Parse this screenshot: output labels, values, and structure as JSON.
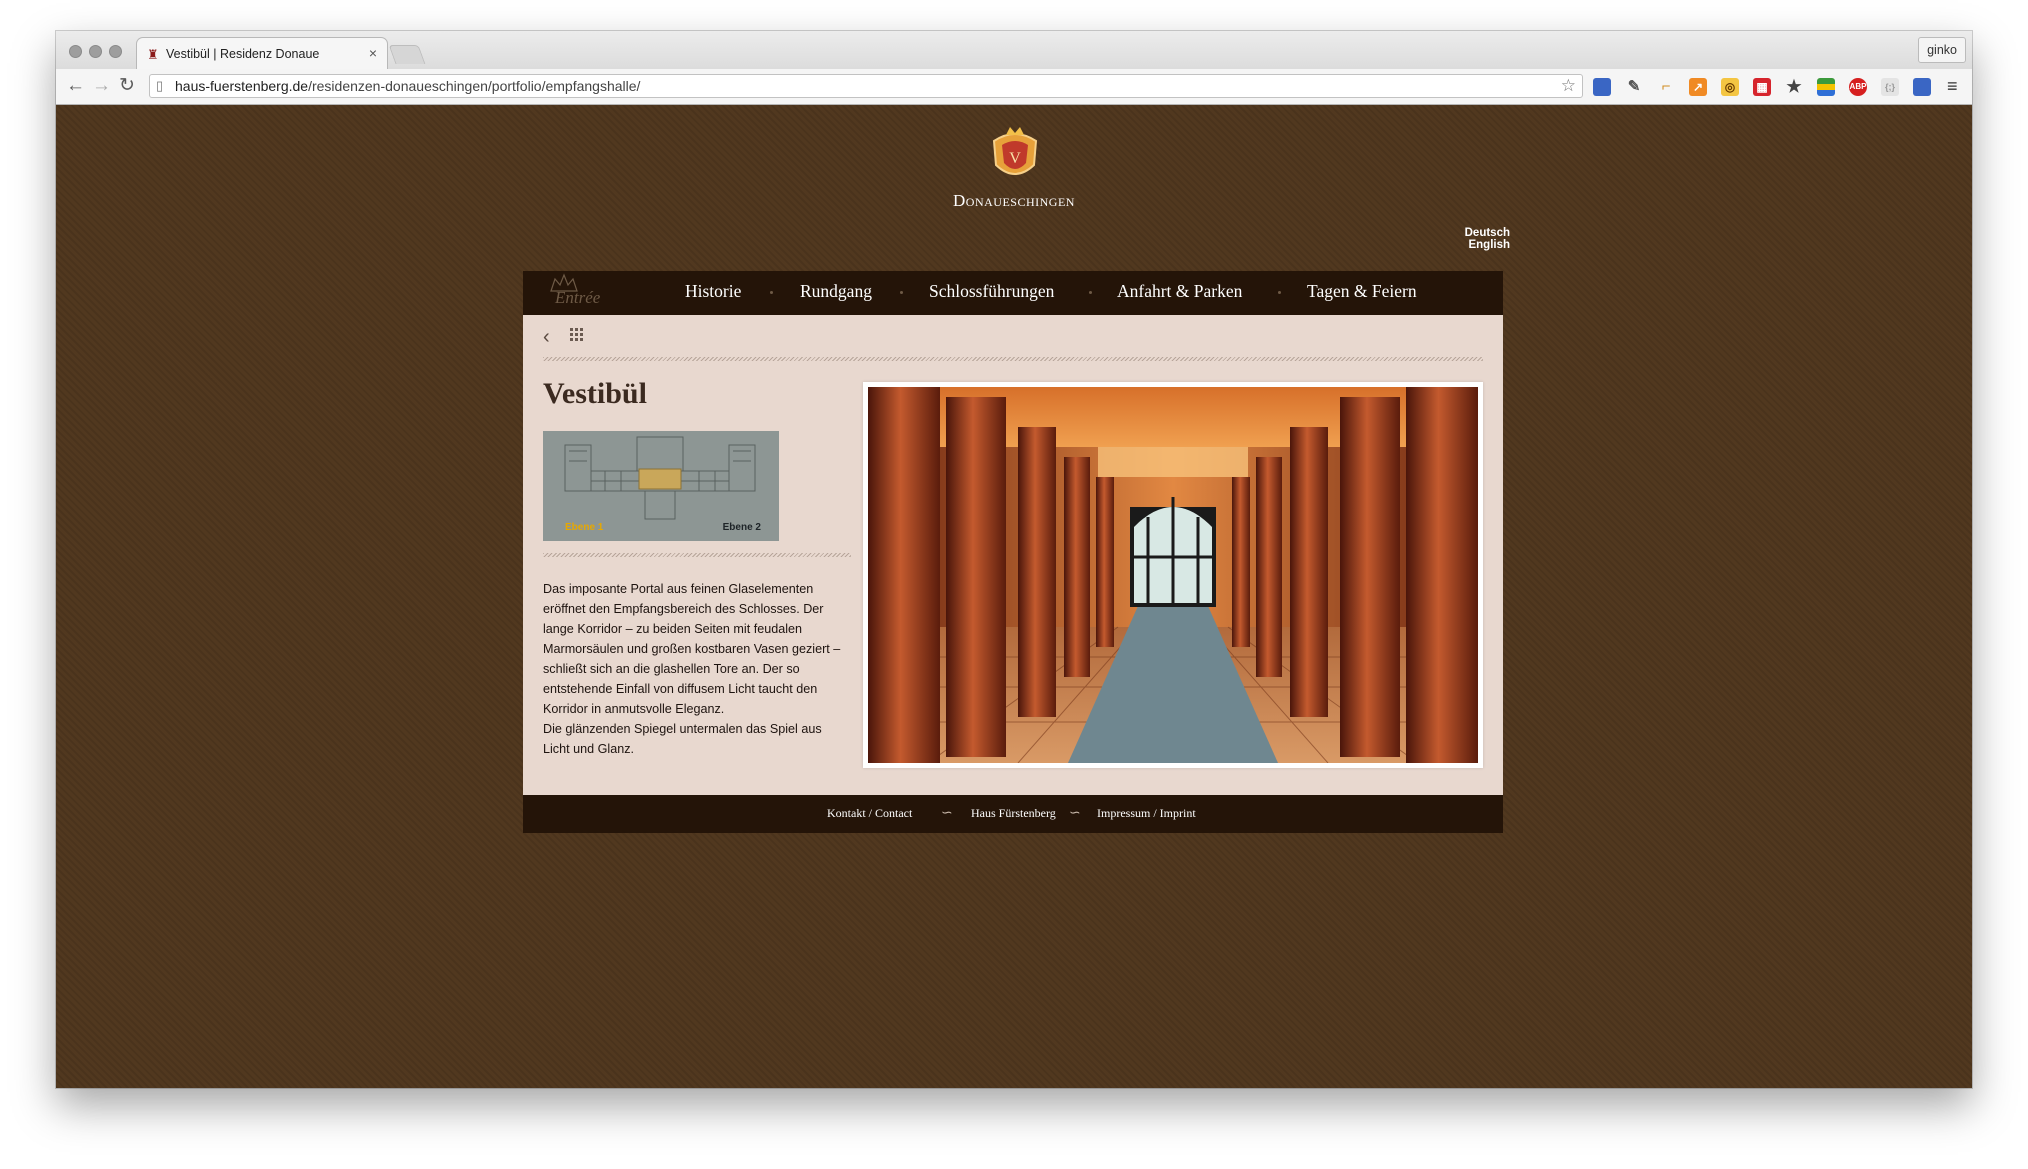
{
  "browser": {
    "tab_title": "Vestibül | Residenz Donaue",
    "tab_close": "×",
    "profile_name": "ginko",
    "url_host": "haus-fuerstenberg.de",
    "url_path": "/residenzen-donaueschingen/portfolio/empfangshalle/",
    "extension_icons": [
      "delicious-icon",
      "eyedropper-icon",
      "ruler-icon",
      "chart-icon",
      "puzzle-icon",
      "red-square-icon",
      "star-icon",
      "colorful-icon",
      "adblock-icon",
      "dev-icon",
      "delicious-icon"
    ],
    "adblock_label": "ABP"
  },
  "site": {
    "brand": "Donaueschingen",
    "languages": [
      "Deutsch",
      "English"
    ],
    "entree_label": "Entrée",
    "nav": [
      "Historie",
      "Rundgang",
      "Schlossführungen",
      "Anfahrt & Parken",
      "Tagen & Feiern"
    ]
  },
  "main": {
    "title": "Vestibül",
    "floorplan_labels": [
      "Ebene 1",
      "Ebene 2"
    ],
    "description": [
      "Das imposante Portal aus feinen Glaselementen eröffnet den Empfangsbereich des Schlosses. Der lange Korridor – zu beiden Seiten mit feudalen Marmorsäulen und großen kostbaren Vasen geziert – schließt sich an die glashellen Tore an. Der so entstehende Einfall von diffusem Licht taucht den Korridor in anmutsvolle Eleganz.",
      "Die glänzenden Spiegel untermalen das Spiel aus Licht und Glanz."
    ]
  },
  "footer": {
    "links": [
      "Kontakt / Contact",
      "Haus Fürstenberg",
      "Impressum / Imprint"
    ]
  },
  "colors": {
    "page_bg": "#51381f",
    "nav_bg": "#241408",
    "content_bg": "#e8d8cf",
    "accent_gold": "#e7a800"
  }
}
